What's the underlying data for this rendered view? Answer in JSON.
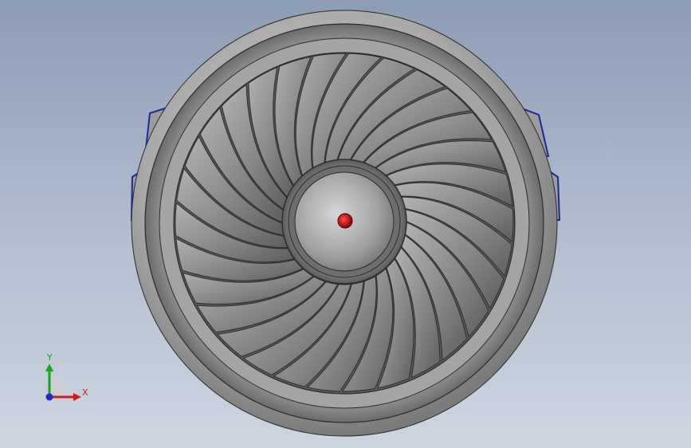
{
  "viewport": {
    "background_top": "#8d9cb5",
    "background_bottom": "#cdd5e0"
  },
  "model": {
    "blade_count": 30,
    "colors": {
      "nacelle": "#a8a8a8",
      "blade": "#8a8a8a",
      "hub": "#9a9a9a",
      "spinner_tip": "#b00000",
      "highlight_edges": "#1a2a9a"
    }
  },
  "triad": {
    "y_label": "Y",
    "x_label": "X",
    "y_color": "#1aa41a",
    "x_color": "#c81e1e",
    "z_color": "#1e2ac8"
  }
}
